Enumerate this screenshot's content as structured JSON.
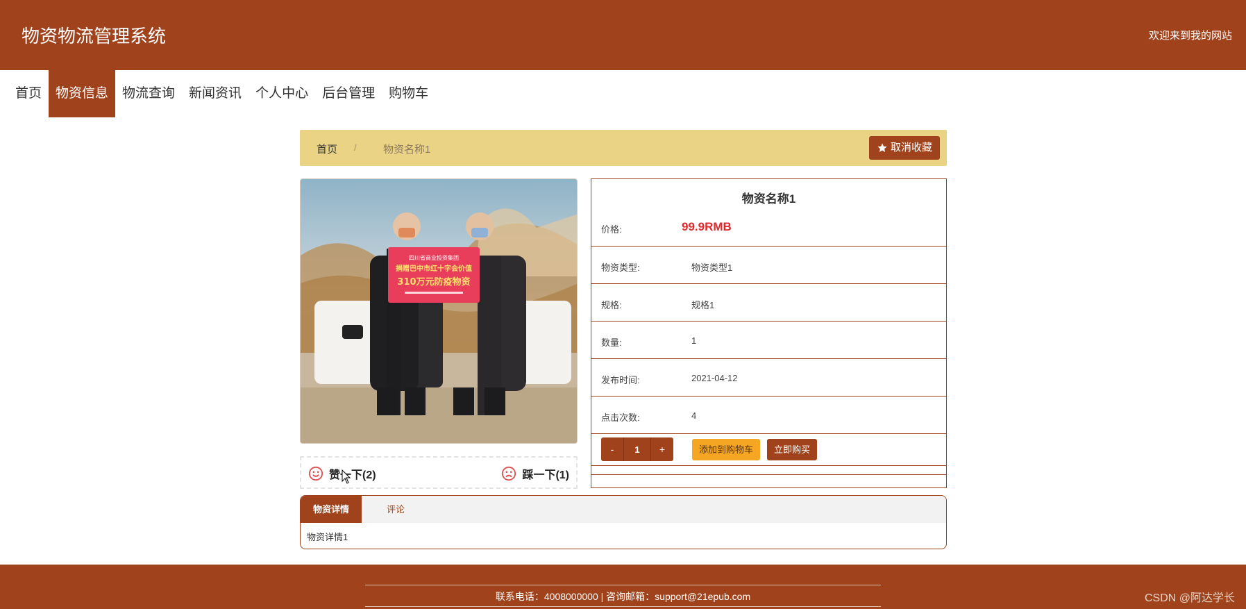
{
  "header": {
    "site_title": "物资物流管理系统",
    "welcome": "欢迎来到我的网站"
  },
  "nav": {
    "items": [
      {
        "label": "首页",
        "active": false
      },
      {
        "label": "物资信息",
        "active": true
      },
      {
        "label": "物流查询",
        "active": false
      },
      {
        "label": "新闻资讯",
        "active": false
      },
      {
        "label": "个人中心",
        "active": false
      },
      {
        "label": "后台管理",
        "active": false
      },
      {
        "label": "购物车",
        "active": false
      }
    ]
  },
  "breadcrumb": {
    "home": "首页",
    "separator": "/",
    "current": "物资名称1",
    "favorite_button": "取消收藏"
  },
  "product": {
    "title": "物资名称1",
    "price_label": "价格:",
    "price_value": "99.9RMB",
    "rows": [
      {
        "label": "物资类型:",
        "value": "物资类型1"
      },
      {
        "label": "规格:",
        "value": "规格1"
      },
      {
        "label": "数量:",
        "value": "1"
      },
      {
        "label": "发布时间:",
        "value": "2021-04-12"
      },
      {
        "label": "点击次数:",
        "value": "4"
      }
    ],
    "image": {
      "banner_line1": "四川省商业投资集团",
      "banner_line2": "捐赠巴中市红十字会价值",
      "banner_line3": "310万元防疫物资"
    }
  },
  "votes": {
    "up_label": "赞一下(2)",
    "down_label": "踩一下(1)"
  },
  "cart": {
    "minus": "-",
    "quantity": "1",
    "plus": "+",
    "add_to_cart": "添加到购物车",
    "buy_now": "立即购买"
  },
  "tabs": {
    "items": [
      {
        "label": "物资详情",
        "active": true
      },
      {
        "label": "评论",
        "active": false
      }
    ],
    "content": "物资详情1"
  },
  "footer": {
    "contact": "联系电话：4008000000 | 咨询邮箱：support@21epub.com",
    "watermark": "CSDN @阿达学长"
  },
  "colors": {
    "brand": "#a0431c",
    "breadcrumb_bg": "#ebd385",
    "price": "#e0292c",
    "add_cart": "#f5a623"
  }
}
